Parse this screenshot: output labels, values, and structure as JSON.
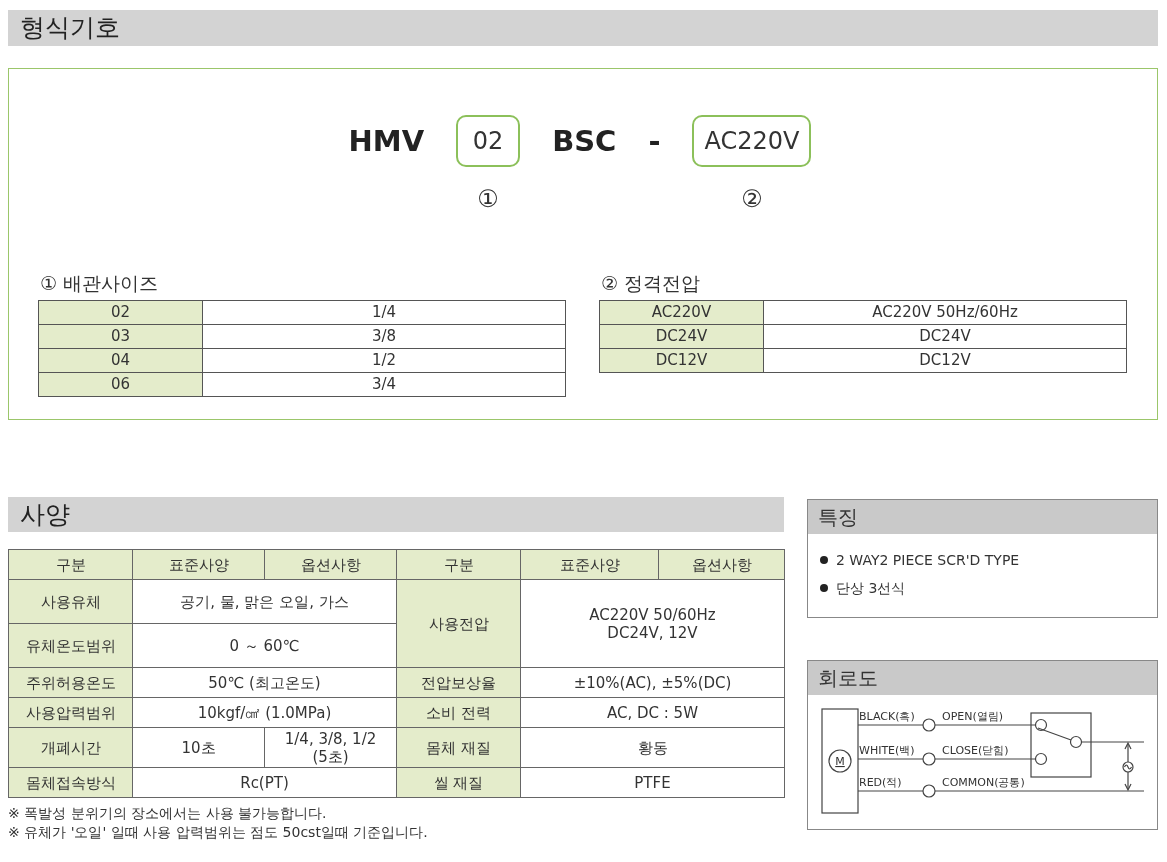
{
  "model_section": {
    "title": "형식기호",
    "code_parts": [
      {
        "kind": "text",
        "text": "HMV"
      },
      {
        "kind": "option",
        "text": "02",
        "marker": "①"
      },
      {
        "kind": "text",
        "text": "BSC"
      },
      {
        "kind": "text",
        "text": "-"
      },
      {
        "kind": "option",
        "text": "AC220V",
        "marker": "②"
      }
    ],
    "option_tables": [
      {
        "title": "① 배관사이즈",
        "rows": [
          [
            "02",
            "1/4"
          ],
          [
            "03",
            "3/8"
          ],
          [
            "04",
            "1/2"
          ],
          [
            "06",
            "3/4"
          ]
        ]
      },
      {
        "title": "② 정격전압",
        "rows": [
          [
            "AC220V",
            "AC220V 50Hz/60Hz"
          ],
          [
            "DC24V",
            "DC24V"
          ],
          [
            "DC12V",
            "DC12V"
          ]
        ]
      }
    ]
  },
  "spec_section": {
    "title": "사양",
    "header": [
      "구분",
      "표준사양",
      "옵션사항",
      "구분",
      "표준사양",
      "옵션사항"
    ],
    "rows": [
      {
        "left_label": "사용유체",
        "left_values": [
          [
            "공기, 물, 맑은 오일, 가스"
          ]
        ],
        "right_label": "사용전압",
        "right_value": [
          "AC220V 50/60Hz",
          "DC24V, 12V"
        ]
      },
      {
        "left_label": "유체온도범위",
        "left_values": [
          [
            "0 ～ 60℃"
          ]
        ]
      },
      {
        "left_label": "주위허용온도",
        "left_values": [
          [
            "50℃ (최고온도)"
          ]
        ],
        "right_label": "전압보상율",
        "right_value": [
          "±10%(AC), ±5%(DC)"
        ]
      },
      {
        "left_label": "사용압력범위",
        "left_values": [
          [
            "10kgf/㎠ (1.0MPa)"
          ]
        ],
        "right_label": "소비 전력",
        "right_value": [
          "AC, DC : 5W"
        ]
      },
      {
        "left_label": "개폐시간",
        "left_values": [
          [
            "10초"
          ],
          [
            "1/4, 3/8, 1/2",
            "(5초)"
          ]
        ],
        "right_label": "몸체 재질",
        "right_value": [
          "황동"
        ]
      },
      {
        "left_label": "몸체접속방식",
        "left_values": [
          [
            "Rc(PT)"
          ]
        ],
        "right_label": "씰 재질",
        "right_value": [
          "PTFE"
        ]
      }
    ],
    "notes": [
      "※  폭발성 분위기의 장소에서는 사용 불가능합니다.",
      "※  유체가 '오일' 일때 사용 압력범위는 점도 50cst일때 기준입니다."
    ]
  },
  "features": {
    "title": "특징",
    "items": [
      "2 WAY2 PIECE SCR'D TYPE",
      "단상 3선식"
    ]
  },
  "circuit": {
    "title": "회로도",
    "motor": "M",
    "wires": [
      {
        "wire": "BLACK(흑)",
        "terminal": "OPEN(열림)"
      },
      {
        "wire": "WHITE(백)",
        "terminal": "CLOSE(닫힘)"
      },
      {
        "wire": "RED(적)",
        "terminal": "COMMON(공통)"
      }
    ]
  }
}
